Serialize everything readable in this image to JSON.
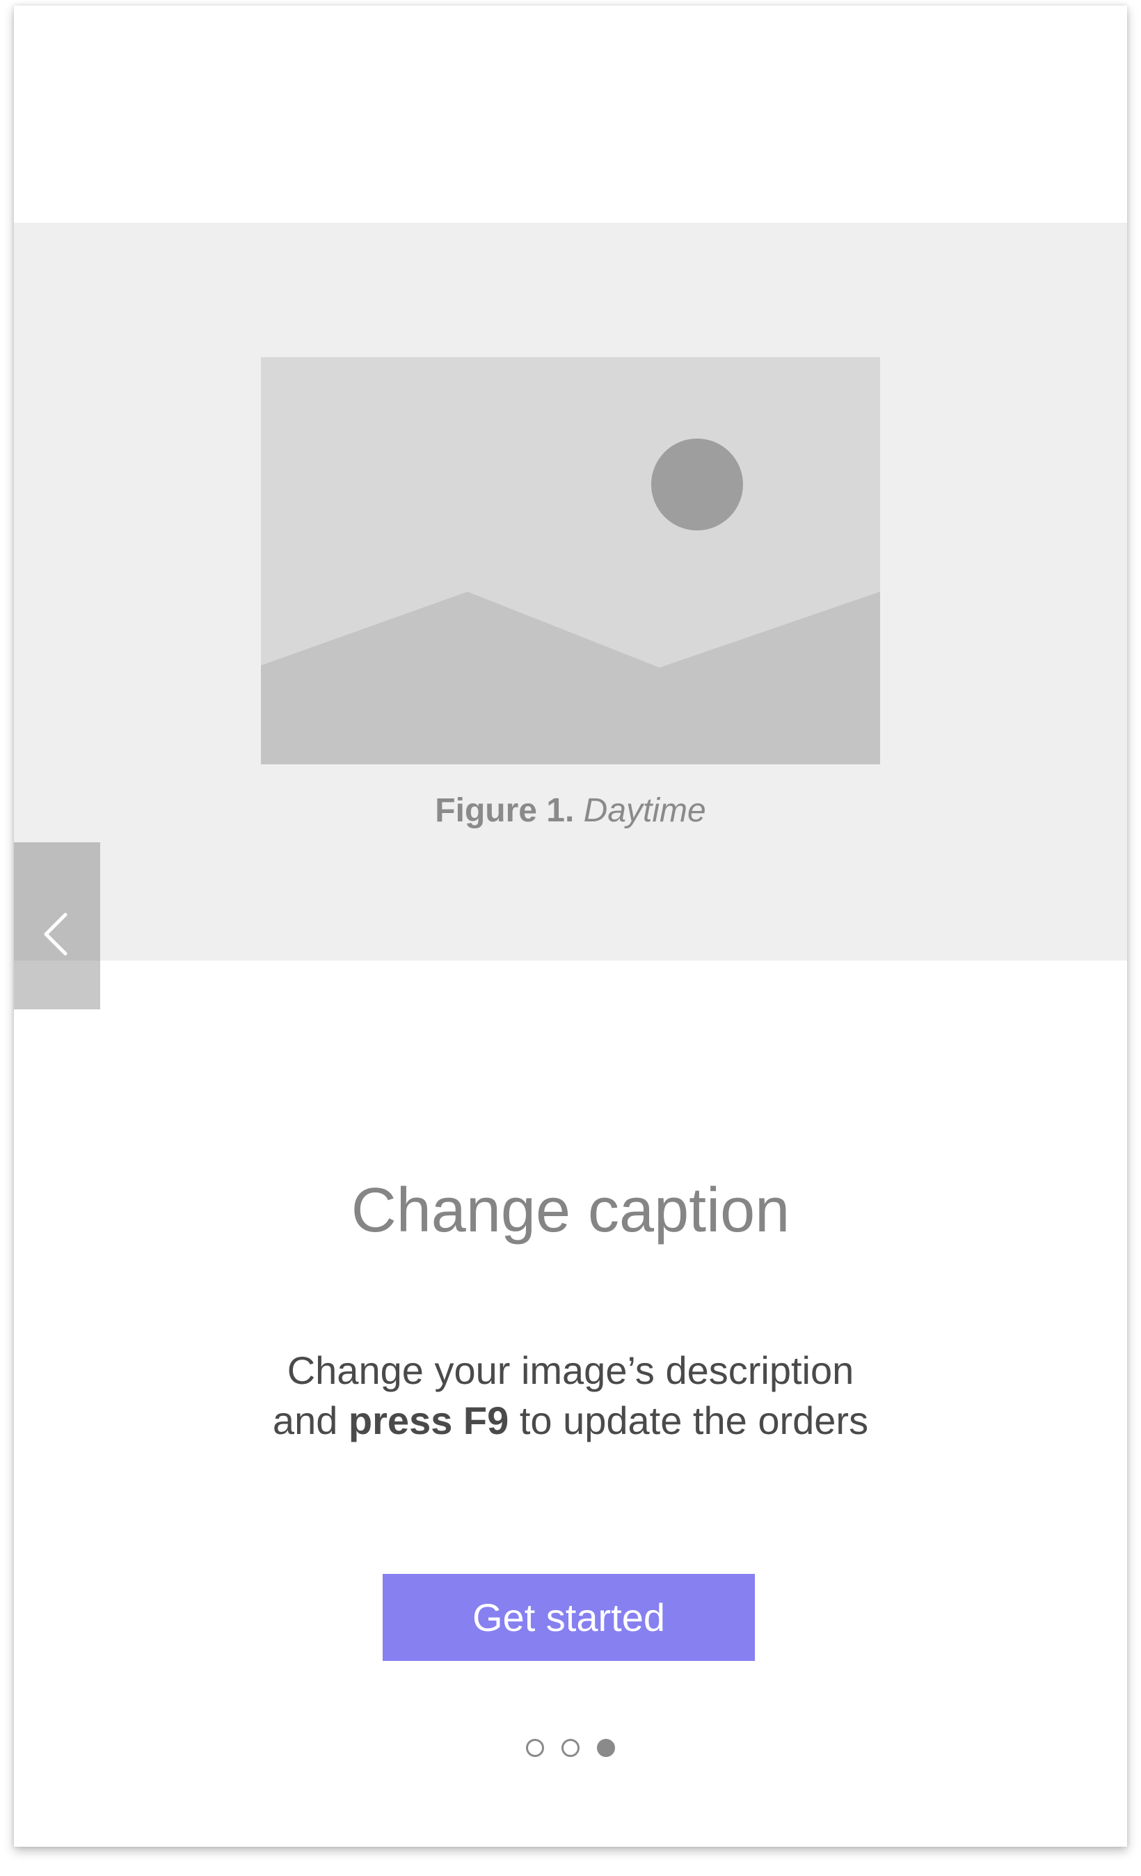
{
  "figure": {
    "label": "Figure 1.",
    "name": "Daytime",
    "image_icon": "image-placeholder-icon"
  },
  "navigation": {
    "previous_icon": "chevron-left-icon"
  },
  "content": {
    "title": "Change caption",
    "description_line1": "Change your image’s description",
    "description_line2_prefix": "and ",
    "description_line2_bold": "press F9",
    "description_line2_suffix": " to update the orders"
  },
  "cta": {
    "label": "Get started"
  },
  "pagination": {
    "total": 3,
    "current": 3
  },
  "colors": {
    "accent": "#8680f0",
    "hero_background": "#efefef",
    "placeholder_light": "#d8d8d8",
    "placeholder_mid": "#c4c4c4",
    "placeholder_dark": "#9e9e9e"
  }
}
